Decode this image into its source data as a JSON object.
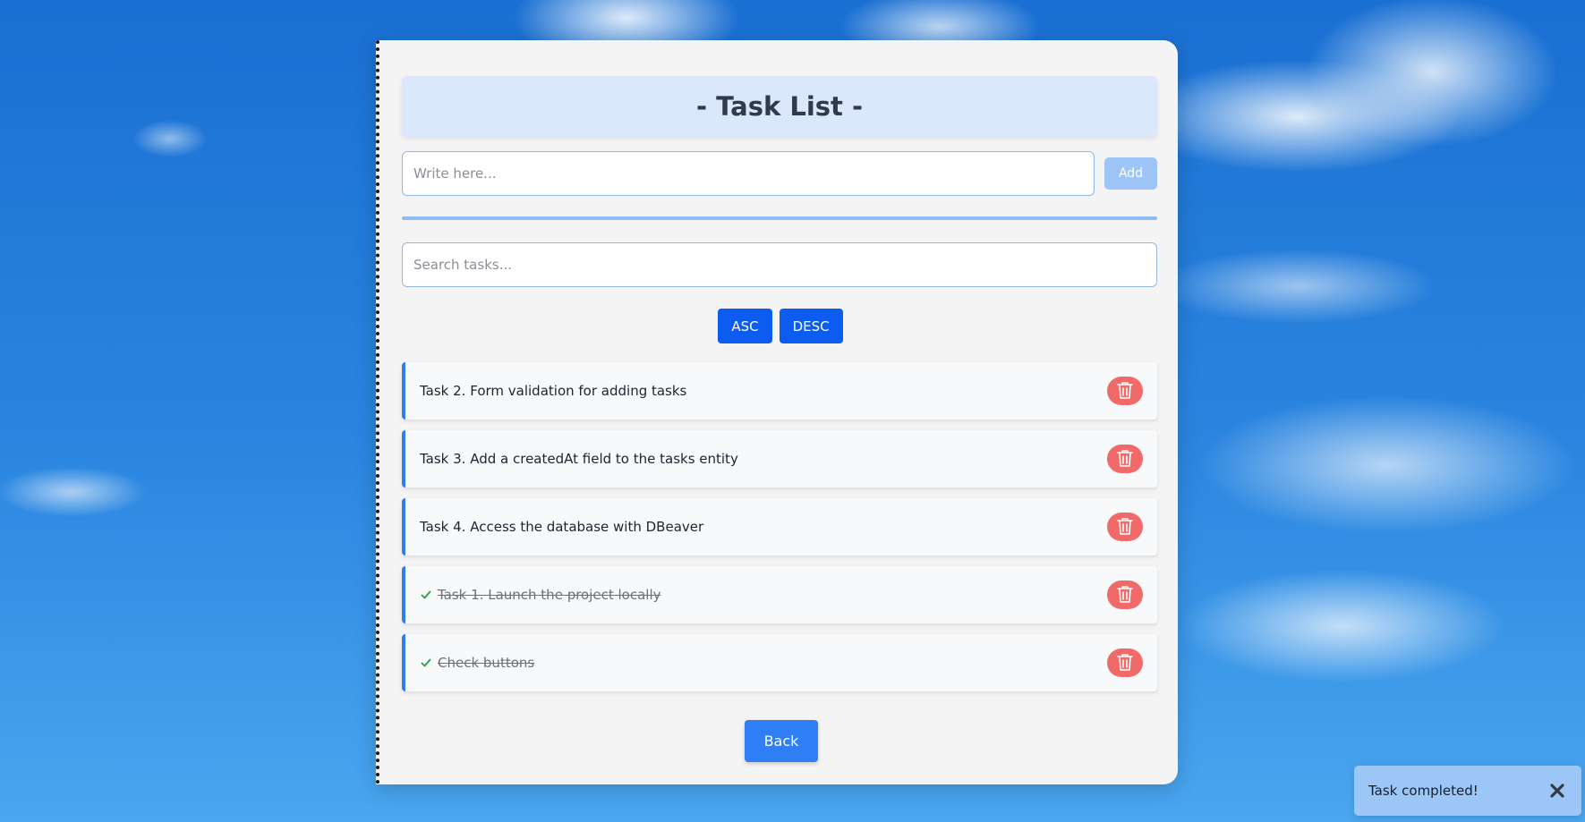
{
  "header": {
    "title": "- Task List -"
  },
  "add_form": {
    "placeholder": "Write here...",
    "value": "",
    "add_label": "Add"
  },
  "search": {
    "placeholder": "Search tasks...",
    "value": ""
  },
  "sort": {
    "asc_label": "ASC",
    "desc_label": "DESC"
  },
  "tasks": [
    {
      "text": "Task 2. Form validation for adding tasks",
      "completed": false
    },
    {
      "text": "Task 3. Add a createdAt field to the tasks entity",
      "completed": false
    },
    {
      "text": "Task 4. Access the database with DBeaver",
      "completed": false
    },
    {
      "text": "Task 1. Launch the project locally",
      "completed": true
    },
    {
      "text": "Check buttons",
      "completed": true
    }
  ],
  "icons": {
    "delete": "trash-icon",
    "completed": "check-icon",
    "close": "close-icon"
  },
  "back_label": "Back",
  "toast": {
    "message": "Task completed!"
  },
  "colors": {
    "primary": "#0d5cf0",
    "accent_border": "#2f7ef0",
    "delete": "#f16a6a",
    "completed_check": "#22a447",
    "toast_bg": "#9cc6f6"
  }
}
